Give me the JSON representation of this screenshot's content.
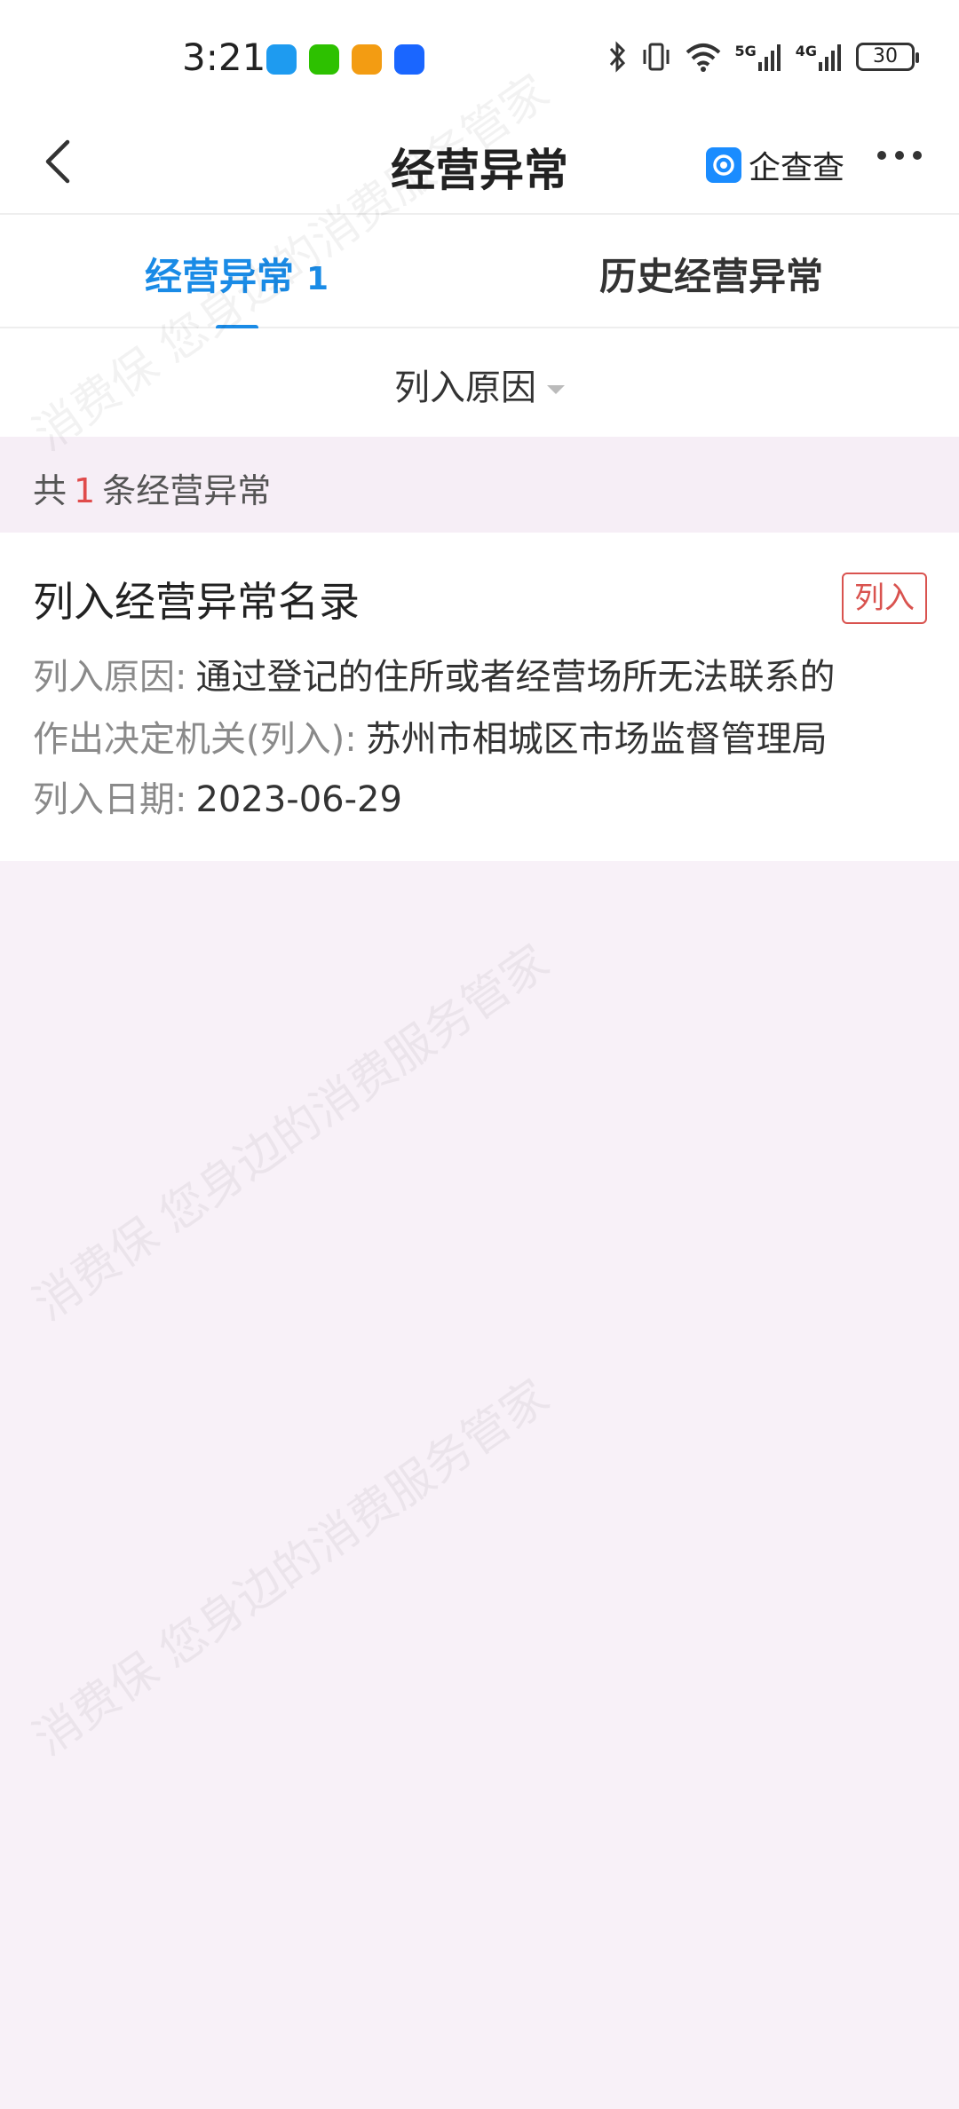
{
  "status_bar": {
    "time": "3:21",
    "network_5g": "5G",
    "network_4g": "4G",
    "battery": "30"
  },
  "nav": {
    "title": "经营异常",
    "brand_name": "企查查"
  },
  "tabs": [
    {
      "label": "经营异常",
      "count": "1"
    },
    {
      "label": "历史经营异常"
    }
  ],
  "filter": {
    "label": "列入原因"
  },
  "summary": {
    "prefix": "共",
    "count": "1",
    "suffix": "条经营异常"
  },
  "record": {
    "title": "列入经营异常名录",
    "badge": "列入",
    "fields": [
      {
        "label": "列入原因:",
        "value": "通过登记的住所或者经营场所无法联系的"
      },
      {
        "label": "作出决定机关(列入):",
        "value": "苏州市相城区市场监督管理局"
      },
      {
        "label": "列入日期:",
        "value": "2023-06-29"
      }
    ]
  },
  "watermark": {
    "line1": "消费保  您身边的消费服务管家"
  },
  "colors": {
    "accent": "#1a8be6",
    "danger": "#e04b4b",
    "background": "#f8f1f8"
  }
}
